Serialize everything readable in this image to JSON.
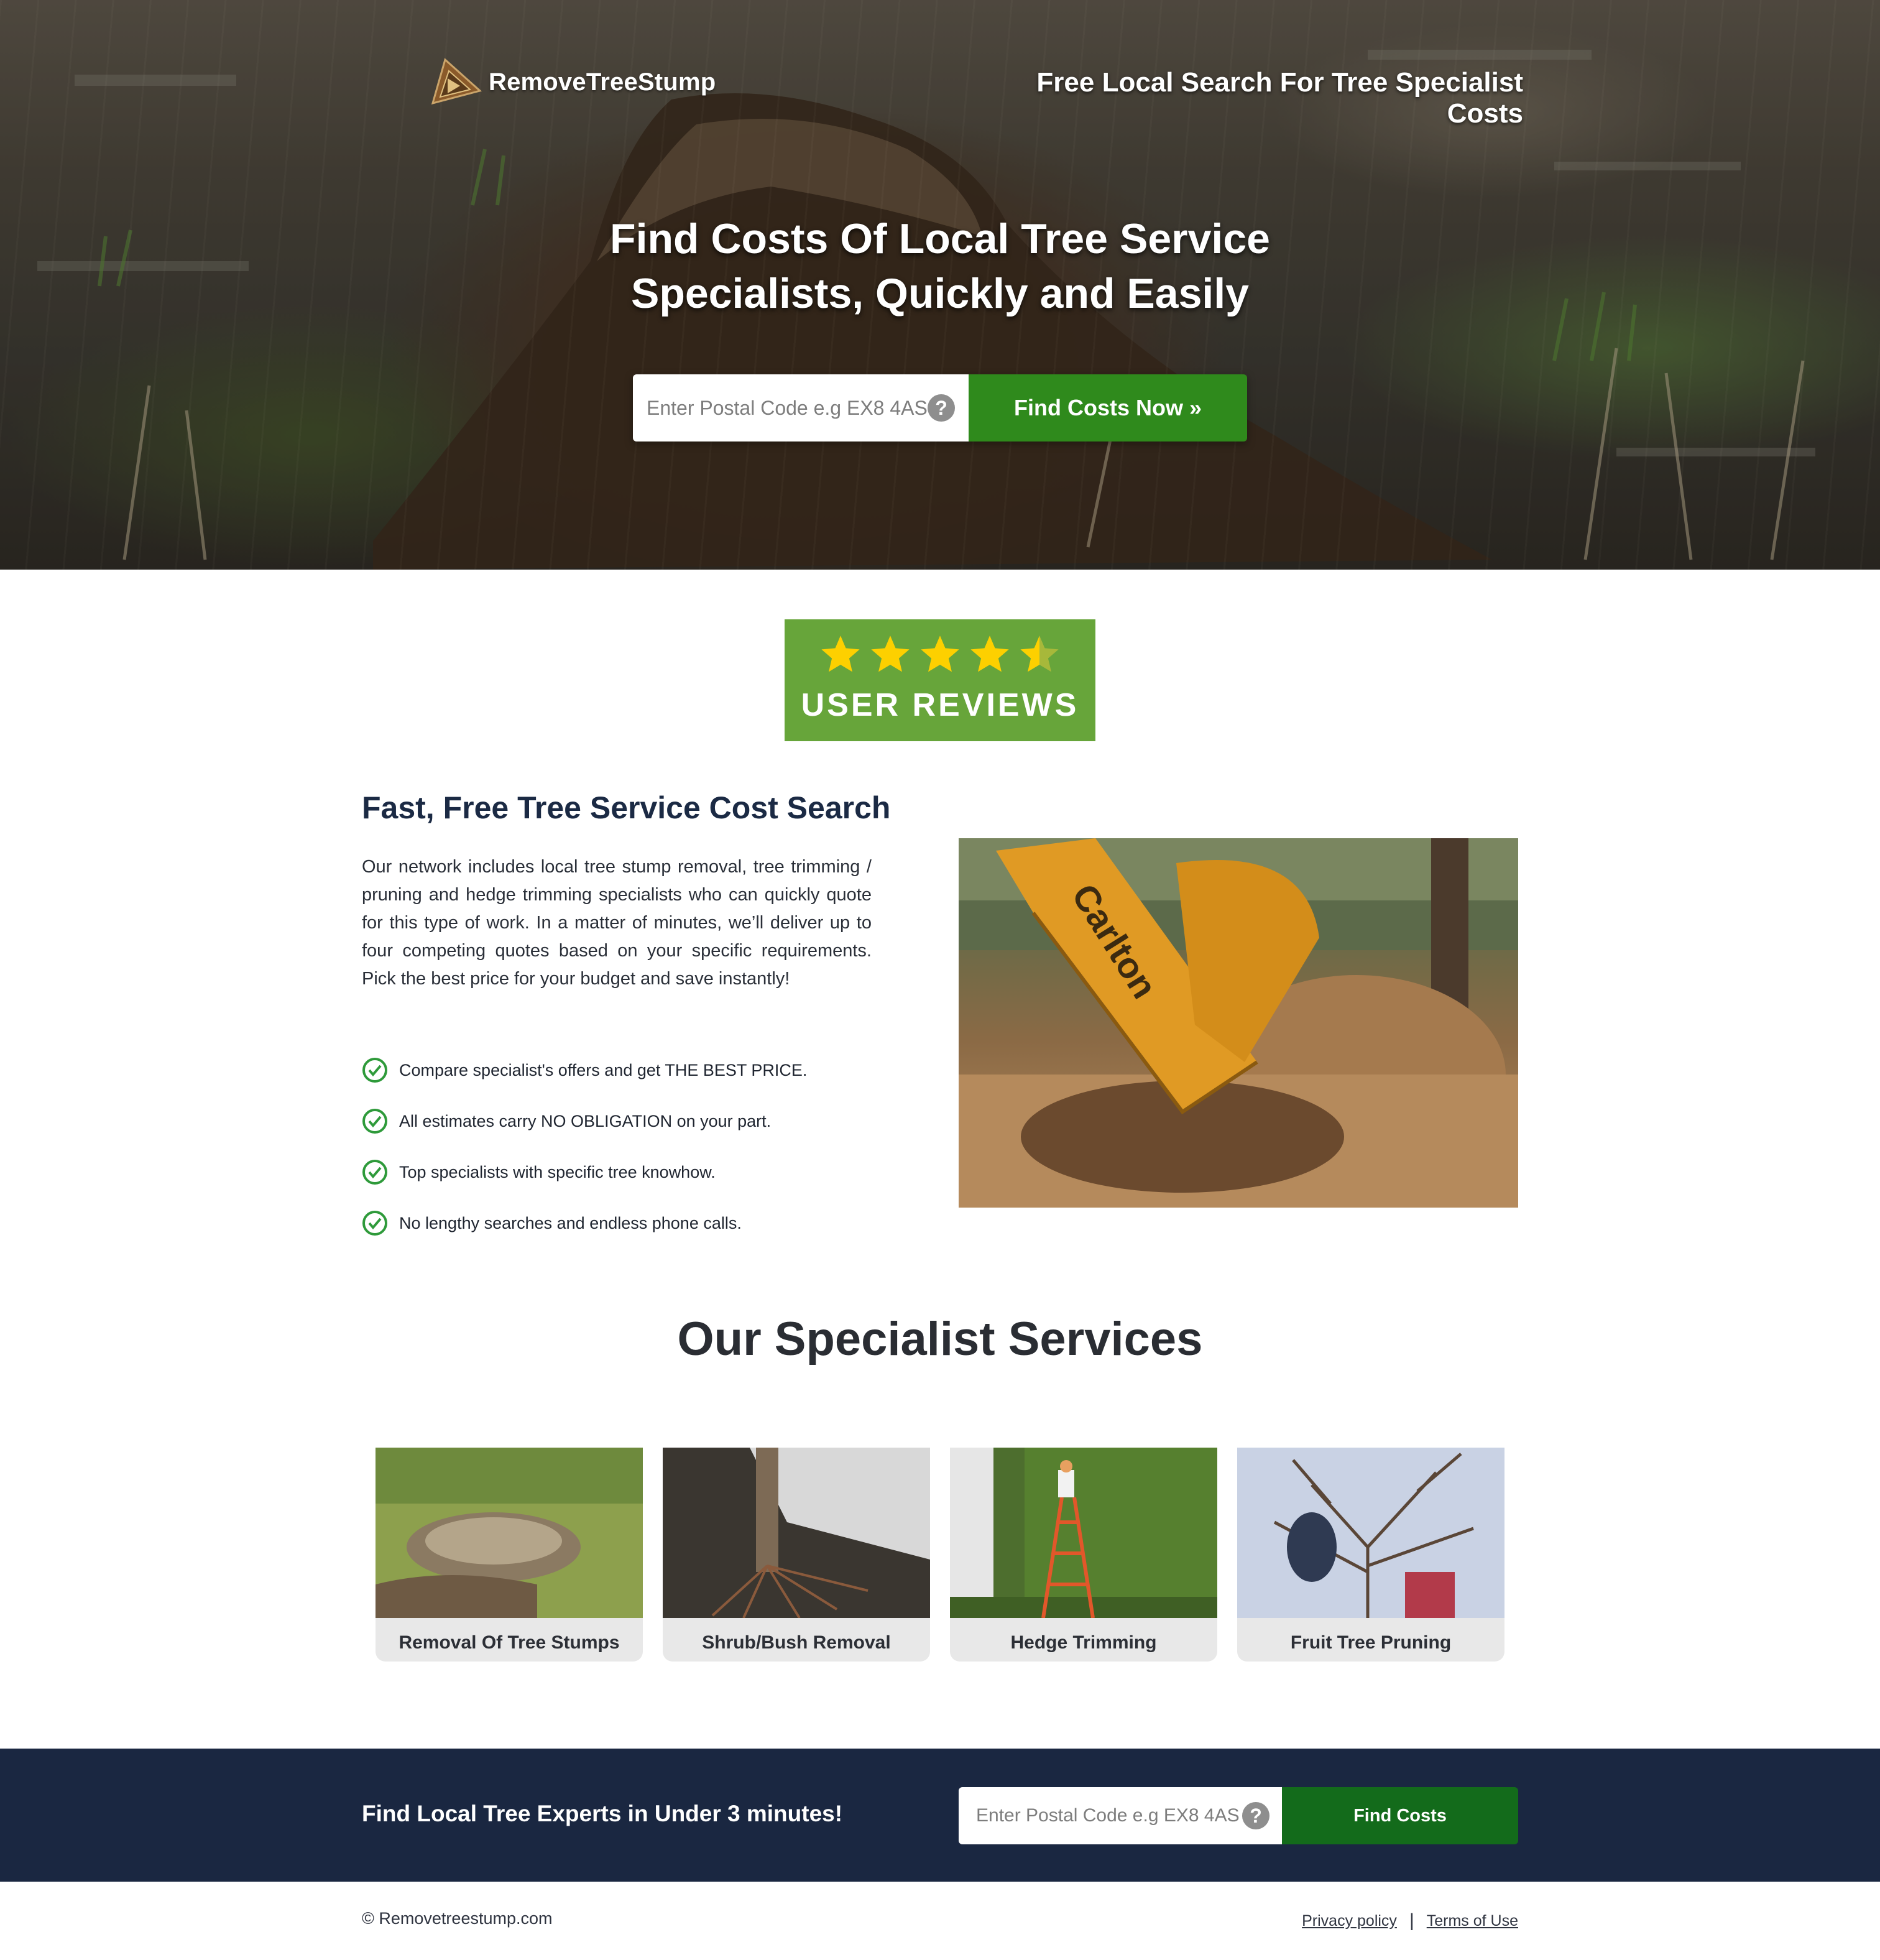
{
  "brand": {
    "name": "RemoveTreeStump",
    "logo_icon": "triangle-play-logo-icon",
    "accent_color": "#2f8a1c",
    "navy_color": "#1a2741"
  },
  "header": {
    "tagline": "Free Local Search For Tree Specialist Costs"
  },
  "hero": {
    "title": "Find Costs Of Local Tree Service Specialists, Quickly and Easily",
    "search": {
      "placeholder": "Enter Postal Code e.g EX8 4AS",
      "value": "",
      "help_icon": "question-circle-icon",
      "button_label": "Find Costs Now »"
    }
  },
  "reviews": {
    "label": "USER REVIEWS",
    "rating": 4.5,
    "max_rating": 5
  },
  "intro": {
    "title": "Fast, Free Tree Service Cost Search",
    "paragraph": "Our network includes local tree stump removal, tree trimming / pruning and hedge trimming specialists who can quickly quote for this type of work. In a matter of minutes, we’ll deliver up to four competing quotes based on your specific requirements. Pick the best price for your budget and save instantly!",
    "benefits": [
      "Compare specialist's offers and get THE BEST PRICE.",
      "All estimates carry NO OBLIGATION on your part.",
      "Top specialists with specific tree knowhow.",
      "No lengthy searches and endless phone calls."
    ],
    "image_text": "Carlton"
  },
  "services": {
    "title": "Our Specialist Services",
    "items": [
      {
        "label": "Removal Of Tree Stumps"
      },
      {
        "label": "Shrub/Bush Removal"
      },
      {
        "label": "Hedge Trimming"
      },
      {
        "label": "Fruit Tree Pruning"
      }
    ]
  },
  "cta": {
    "text": "Find Local Tree Experts in Under 3 minutes!",
    "placeholder": "Enter Postal Code e.g EX8 4AS",
    "value": "",
    "help_icon": "question-circle-icon",
    "button_label": "Find Costs"
  },
  "footer": {
    "copyright": "© Removetreestump.com",
    "links": [
      "Privacy policy",
      "Terms of Use"
    ],
    "separator": "|"
  }
}
